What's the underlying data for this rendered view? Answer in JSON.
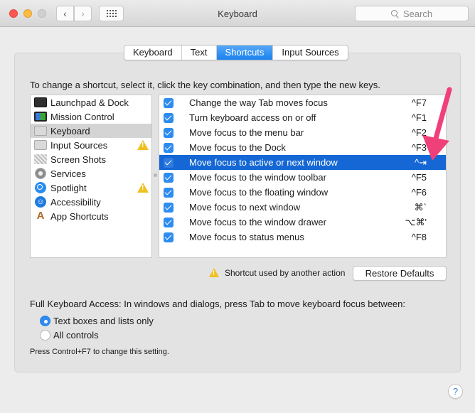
{
  "window": {
    "title": "Keyboard",
    "search_placeholder": "Search",
    "back_glyph": "‹",
    "forward_glyph": "›"
  },
  "tabs": [
    {
      "label": "Keyboard",
      "active": false
    },
    {
      "label": "Text",
      "active": false
    },
    {
      "label": "Shortcuts",
      "active": true
    },
    {
      "label": "Input Sources",
      "active": false
    }
  ],
  "instruction": "To change a shortcut, select it, click the key combination, and then type the new keys.",
  "categories": [
    {
      "label": "Launchpad & Dock",
      "icon": "launchpad-icon",
      "selected": false,
      "warning": false
    },
    {
      "label": "Mission Control",
      "icon": "mission-control-icon",
      "selected": false,
      "warning": false
    },
    {
      "label": "Keyboard",
      "icon": "keyboard-icon",
      "selected": true,
      "warning": false
    },
    {
      "label": "Input Sources",
      "icon": "keyboard-icon",
      "selected": false,
      "warning": true
    },
    {
      "label": "Screen Shots",
      "icon": "screenshot-icon",
      "selected": false,
      "warning": false
    },
    {
      "label": "Services",
      "icon": "gear-icon",
      "selected": false,
      "warning": false
    },
    {
      "label": "Spotlight",
      "icon": "spotlight-icon",
      "selected": false,
      "warning": true
    },
    {
      "label": "Accessibility",
      "icon": "accessibility-icon",
      "selected": false,
      "warning": false
    },
    {
      "label": "App Shortcuts",
      "icon": "app-shortcuts-icon",
      "selected": false,
      "warning": false
    }
  ],
  "shortcuts": [
    {
      "label": "Change the way Tab moves focus",
      "key": "^F7",
      "checked": true,
      "selected": false
    },
    {
      "label": "Turn keyboard access on or off",
      "key": "^F1",
      "checked": true,
      "selected": false
    },
    {
      "label": "Move focus to the menu bar",
      "key": "^F2",
      "checked": true,
      "selected": false
    },
    {
      "label": "Move focus to the Dock",
      "key": "^F3",
      "checked": true,
      "selected": false
    },
    {
      "label": "Move focus to active or next window",
      "key": "^⇥",
      "checked": true,
      "selected": true
    },
    {
      "label": "Move focus to the window toolbar",
      "key": "^F5",
      "checked": true,
      "selected": false
    },
    {
      "label": "Move focus to the floating window",
      "key": "^F6",
      "checked": true,
      "selected": false
    },
    {
      "label": "Move focus to next window",
      "key": "⌘`",
      "checked": true,
      "selected": false
    },
    {
      "label": "Move focus to the window drawer",
      "key": "⌥⌘'",
      "checked": true,
      "selected": false
    },
    {
      "label": "Move focus to status menus",
      "key": "^F8",
      "checked": true,
      "selected": false
    }
  ],
  "legend": "Shortcut used by another action",
  "restore_defaults": "Restore Defaults",
  "full_keyboard_access": {
    "label": "Full Keyboard Access: In windows and dialogs, press Tab to move keyboard focus between:",
    "options": [
      {
        "label": "Text boxes and lists only",
        "selected": true
      },
      {
        "label": "All controls",
        "selected": false
      }
    ],
    "hint": "Press Control+F7 to change this setting."
  },
  "help_glyph": "?",
  "colors": {
    "accent": "#1467d4",
    "annotation_arrow": "#f0407a",
    "warning": "#f0c020"
  }
}
